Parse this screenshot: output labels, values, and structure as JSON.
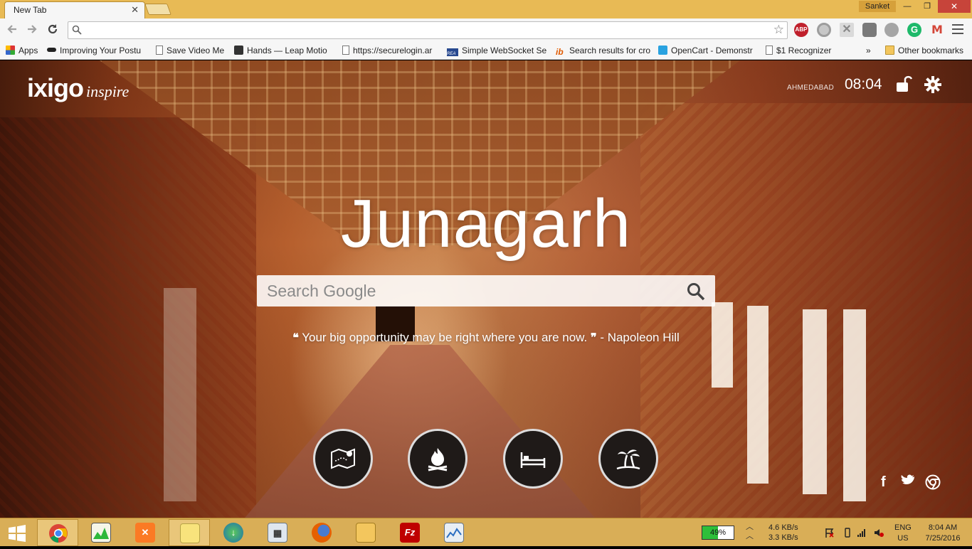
{
  "browser": {
    "tab_title": "New Tab",
    "tab_close": "✕",
    "user": "Sanket",
    "window_controls": {
      "minimize": "—",
      "maximize": "❐",
      "close": "✕"
    },
    "omnibox_value": "",
    "extensions": [
      "adblock-plus",
      "search-extension",
      "x-extension",
      "spy-extension",
      "mail-checker",
      "grammarly",
      "gmail"
    ],
    "extension_labels": {
      "abp": "ABP",
      "x": "✕",
      "g": "G",
      "gmail": "M"
    }
  },
  "bookmarks": {
    "items": [
      {
        "label": "Apps",
        "icon": "apps-grid-icon"
      },
      {
        "label": "Improving Your Postu",
        "icon": "mustache-icon"
      },
      {
        "label": "Save Video Me",
        "icon": "page-icon"
      },
      {
        "label": "Hands — Leap Motio",
        "icon": "leap-icon"
      },
      {
        "label": "https://securelogin.ar",
        "icon": "page-icon"
      },
      {
        "label": "Simple WebSocket Se",
        "icon": "rea-icon"
      },
      {
        "label": "Search results for cro",
        "icon": "ib-icon"
      },
      {
        "label": "OpenCart - Demonstr",
        "icon": "cart-icon"
      },
      {
        "label": "$1 Recognizer",
        "icon": "page-icon"
      }
    ],
    "overflow": "»",
    "other": "Other bookmarks",
    "rea_text": "REA",
    "ib_text": "ib"
  },
  "page": {
    "brand_name": "ixigo",
    "brand_sub": "inspire",
    "city": "AHMEDABAD",
    "time": "08:04",
    "destination": "Junagarh",
    "search_placeholder": "Search Google",
    "quote_text": "Your big opportunity may be right where you are now.",
    "quote_author": "- Napoleon Hill",
    "quote_open": "❝",
    "quote_close": "❞",
    "categories": [
      "map",
      "camping",
      "stay",
      "beach"
    ],
    "social": {
      "facebook": "f",
      "twitter": "🐦",
      "chrome": "◎"
    }
  },
  "taskbar": {
    "apps": [
      "chrome",
      "task-manager",
      "xampp",
      "sticky-notes",
      "internet-download-manager",
      "calculator",
      "firefox",
      "file-explorer",
      "filezilla",
      "performance-monitor"
    ],
    "battery_percent": 49,
    "battery_label": "49%",
    "net_up": "4.6 KB/s",
    "net_down": "3.3 KB/s",
    "lang": "ENG",
    "region": "US",
    "time": "8:04 AM",
    "date": "7/25/2016"
  },
  "colors": {
    "title_bar": "#e8ba55",
    "taskbar": "#d9ae57",
    "close_red": "#c7443a",
    "battery_green": "#2dbf3a"
  }
}
